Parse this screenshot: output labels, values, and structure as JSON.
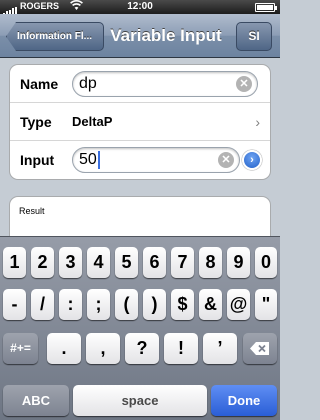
{
  "status_bar": {
    "carrier": "ROGERS",
    "time": "12:00",
    "wifi_icon": "wifi-icon",
    "battery_icon": "battery-icon"
  },
  "navbar": {
    "back_label": "Information Fl...",
    "title": "Variable Input",
    "right_label": "SI"
  },
  "form": {
    "name_label": "Name",
    "name_value": "dp",
    "type_label": "Type",
    "type_value": "DeltaP",
    "input_label": "Input",
    "input_value": "50"
  },
  "result": {
    "label": "Result"
  },
  "keyboard": {
    "row1": [
      "1",
      "2",
      "3",
      "4",
      "5",
      "6",
      "7",
      "8",
      "9",
      "0"
    ],
    "row2": [
      "-",
      "/",
      ":",
      ";",
      "(",
      ")",
      "$",
      "&",
      "@",
      "\""
    ],
    "row3_left": "#+=",
    "row3": [
      ".",
      ",",
      "?",
      "!",
      "’"
    ],
    "bottom_left": "ABC",
    "space": "space",
    "done": "Done"
  },
  "colors": {
    "nav": "#6d83a0",
    "done": "#2a5ed6",
    "background": "#c5ccd4"
  }
}
